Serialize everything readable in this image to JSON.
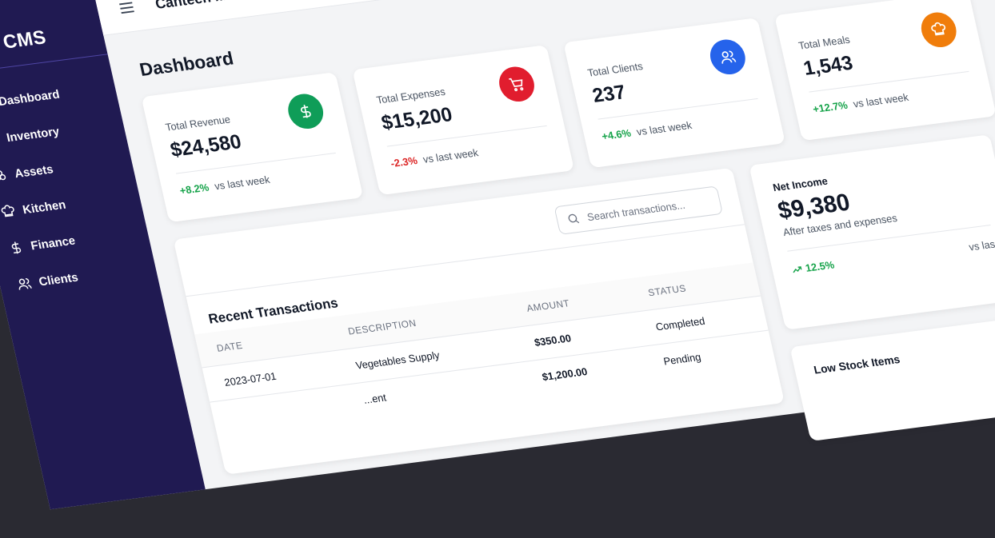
{
  "sidebar": {
    "logo": "CMS",
    "items": [
      {
        "label": "Dashboard",
        "icon": "home-icon"
      },
      {
        "label": "Inventory",
        "icon": "box-icon"
      },
      {
        "label": "Assets",
        "icon": "assets-icon"
      },
      {
        "label": "Kitchen",
        "icon": "chef-hat-icon"
      },
      {
        "label": "Finance",
        "icon": "dollar-icon"
      },
      {
        "label": "Clients",
        "icon": "users-icon"
      }
    ]
  },
  "topbar": {
    "title": "Canteen Manage",
    "menu_icon": "hamburger-icon"
  },
  "page": {
    "title": "Dashboard"
  },
  "cards": [
    {
      "label": "Total Revenue",
      "value": "$24,580",
      "change": "+8.2%",
      "direction": "up",
      "vs": "vs last week",
      "icon": "dollar-icon",
      "color": "#0f9d58"
    },
    {
      "label": "Total Expenses",
      "value": "$15,200",
      "change": "-2.3%",
      "direction": "down",
      "vs": "vs last week",
      "icon": "cart-icon",
      "color": "#e11d2e"
    },
    {
      "label": "Total Clients",
      "value": "237",
      "change": "+4.6%",
      "direction": "up",
      "vs": "vs last week",
      "icon": "users-icon",
      "color": "#2563eb"
    },
    {
      "label": "Total Meals",
      "value": "1,543",
      "change": "+12.7%",
      "direction": "up",
      "vs": "vs last week",
      "icon": "chef-hat-icon",
      "color": "#f07d0b"
    }
  ],
  "transactions": {
    "title": "Recent Transactions",
    "search_placeholder": "Search transactions...",
    "columns": [
      "DATE",
      "DESCRIPTION",
      "AMOUNT",
      "STATUS"
    ],
    "rows": [
      {
        "date": "2023-07-01",
        "description": "Vegetables Supply",
        "amount": "$350.00",
        "status": "Completed"
      },
      {
        "date": "",
        "description": "...ent",
        "amount": "$1,200.00",
        "status": "Pending"
      }
    ]
  },
  "net_income": {
    "label": "Net Income",
    "value": "$9,380",
    "sub": "After taxes and expenses",
    "change": "12.5%",
    "vs": "vs las"
  },
  "low_stock": {
    "title": "Low Stock Items"
  }
}
